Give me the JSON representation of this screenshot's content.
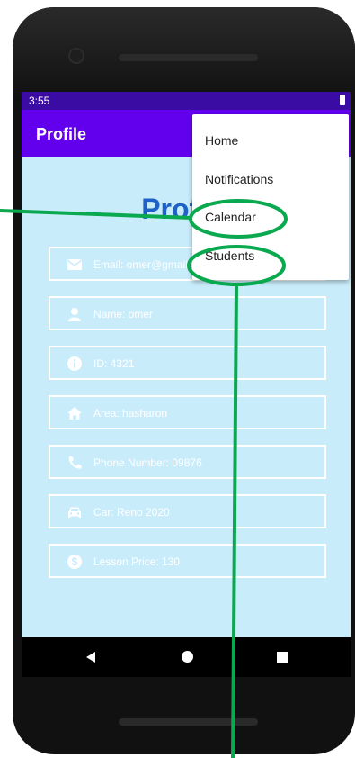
{
  "status": {
    "time": "3:55"
  },
  "appbar": {
    "title": "Profile"
  },
  "page": {
    "heading": "Profile"
  },
  "fields": [
    {
      "icon": "mail-icon",
      "text": "Email: omer@gmail.com"
    },
    {
      "icon": "person-icon",
      "text": "Name: omer"
    },
    {
      "icon": "info-icon",
      "text": "ID: 4321"
    },
    {
      "icon": "home-icon",
      "text": "Area: hasharon"
    },
    {
      "icon": "phone-icon",
      "text": "Phone Number: 09876"
    },
    {
      "icon": "car-icon",
      "text": "Car: Reno 2020"
    },
    {
      "icon": "dollar-icon",
      "text": "Lesson Price: 130"
    }
  ],
  "menu": {
    "items": [
      "Home",
      "Notifications",
      "Calendar",
      "Students"
    ]
  },
  "colors": {
    "statusbar": "#3a0ca3",
    "appbar": "#6200ee",
    "background": "#c9ecfb",
    "heading": "#1e62c8",
    "annotation": "#0aa84f"
  }
}
